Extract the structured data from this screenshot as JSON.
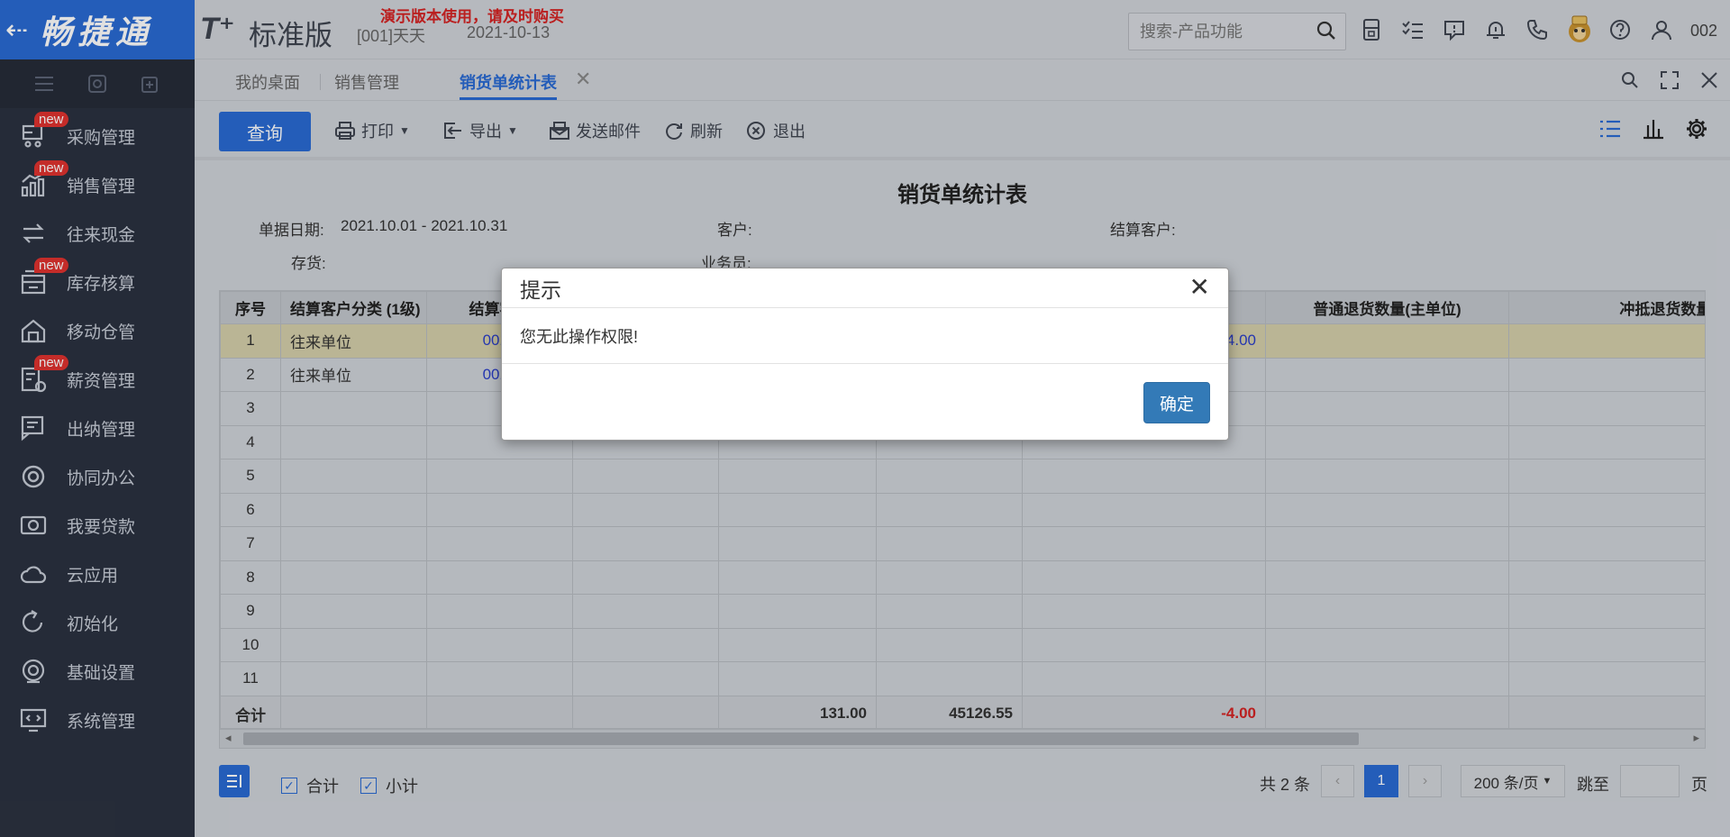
{
  "brand": {
    "back": "⇠",
    "name": "畅捷通"
  },
  "sidebar": {
    "items": [
      {
        "label": "采购管理",
        "icon": "purchase-icon",
        "badge": "new"
      },
      {
        "label": "销售管理",
        "icon": "sales-chart-icon",
        "badge": "new"
      },
      {
        "label": "往来现金",
        "icon": "exchange-arrows-icon",
        "badge": ""
      },
      {
        "label": "库存核算",
        "icon": "inventory-icon",
        "badge": "new"
      },
      {
        "label": "移动仓管",
        "icon": "mobile-warehouse-icon",
        "badge": ""
      },
      {
        "label": "薪资管理",
        "icon": "payroll-icon",
        "badge": "new"
      },
      {
        "label": "出纳管理",
        "icon": "cashier-icon",
        "badge": ""
      },
      {
        "label": "协同办公",
        "icon": "collaboration-icon",
        "badge": ""
      },
      {
        "label": "我要贷款",
        "icon": "loan-icon",
        "badge": ""
      },
      {
        "label": "云应用",
        "icon": "cloud-icon",
        "badge": ""
      },
      {
        "label": "初始化",
        "icon": "init-icon",
        "badge": ""
      },
      {
        "label": "基础设置",
        "icon": "basic-settings-icon",
        "badge": ""
      },
      {
        "label": "系统管理",
        "icon": "system-admin-icon",
        "badge": ""
      }
    ]
  },
  "header": {
    "logo_t": "T⁺",
    "logo_edition": "标准版",
    "demo_note": "演示版本使用，请及时购买",
    "org": "[001]天天",
    "date": "2021-10-13",
    "search_placeholder": "搜索-产品功能",
    "user_code": "002"
  },
  "tabs": [
    {
      "label": "我的桌面"
    },
    {
      "label": "销售管理"
    },
    {
      "label": "销货单统计表",
      "active": true
    }
  ],
  "toolbar": {
    "query": "查询",
    "print": "打印",
    "export": "导出",
    "email": "发送邮件",
    "refresh": "刷新",
    "exit": "退出"
  },
  "report": {
    "title": "销货单统计表",
    "filters": {
      "date_label": "单据日期:",
      "date_value": "2021.10.01 - 2021.10.31",
      "customer_label": "客户:",
      "settle_customer_label": "结算客户:",
      "stock_label": "存货:",
      "salesman_label": "业务员:"
    },
    "columns": [
      "序号",
      "结算客户分类 (1级)",
      "结算客户",
      "",
      "",
      "",
      "",
      "普通退货数量(主单位)",
      "冲抵退货数量(主单位)"
    ],
    "rows": [
      [
        "1",
        "往来单位",
        "0010",
        "",
        "",
        "",
        "-4.00",
        "",
        ""
      ],
      [
        "2",
        "往来单位",
        "0010",
        "",
        "",
        "",
        "",
        "",
        ""
      ],
      [
        "3",
        "",
        "",
        "",
        "",
        "",
        "",
        "",
        ""
      ],
      [
        "4",
        "",
        "",
        "",
        "",
        "",
        "",
        "",
        ""
      ],
      [
        "5",
        "",
        "",
        "",
        "",
        "",
        "",
        "",
        ""
      ],
      [
        "6",
        "",
        "",
        "",
        "",
        "",
        "",
        "",
        ""
      ],
      [
        "7",
        "",
        "",
        "",
        "",
        "",
        "",
        "",
        ""
      ],
      [
        "8",
        "",
        "",
        "",
        "",
        "",
        "",
        "",
        ""
      ],
      [
        "9",
        "",
        "",
        "",
        "",
        "",
        "",
        "",
        ""
      ],
      [
        "10",
        "",
        "",
        "",
        "",
        "",
        "",
        "",
        ""
      ],
      [
        "11",
        "",
        "",
        "",
        "",
        "",
        "",
        "",
        ""
      ]
    ],
    "total": {
      "label": "合计",
      "qty": "131.00",
      "amount": "45126.55",
      "return": "-4.00"
    }
  },
  "footer": {
    "chk_total": "合计",
    "chk_subtotal": "小计",
    "count": "共 2 条",
    "prev": "‹",
    "page": "1",
    "next": "›",
    "page_size": "200 条/页",
    "jump_label": "跳至",
    "page_suffix": "页"
  },
  "modal": {
    "title": "提示",
    "message": "您无此操作权限!",
    "ok": "确定",
    "close": "✕"
  },
  "colors": {
    "brand_blue": "#2a6ad3",
    "sidebar": "#2b3240",
    "badge_red": "#e0332f",
    "negative": "#d42424"
  }
}
